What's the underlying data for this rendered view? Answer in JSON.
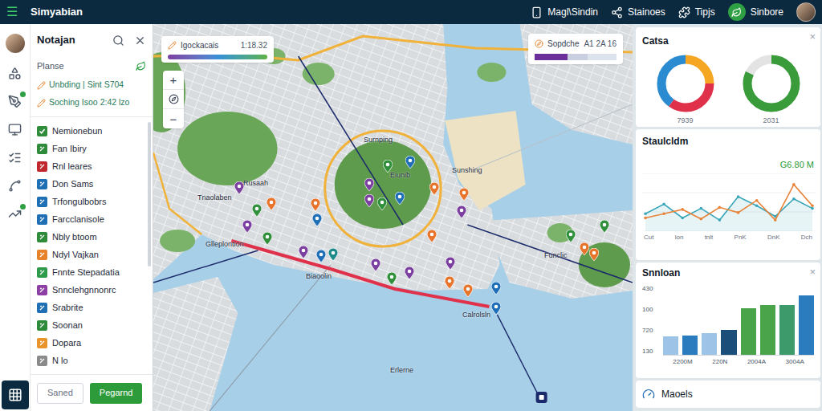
{
  "topbar": {
    "menu_glyph": "☰",
    "title": "Simyabian",
    "items": [
      {
        "label": "Magl\\Sindin"
      },
      {
        "label": "Stainoes"
      },
      {
        "label": "Tipjs"
      }
    ],
    "status": {
      "label": "Sinbore"
    }
  },
  "left_panel": {
    "title": "Notajan",
    "section": "Planse",
    "entries": [
      "Unbding | Sint S704",
      "Soching Isoo 2:42 lzo"
    ],
    "layers": [
      {
        "name": "Nemionebun",
        "color": "#2e8b3a",
        "checked": true
      },
      {
        "name": "Fan Ibiry",
        "color": "#2e8b3a",
        "checked": false
      },
      {
        "name": "Rnl leares",
        "color": "#c0282d",
        "checked": false
      },
      {
        "name": "Don Sams",
        "color": "#1f6fb5",
        "checked": false
      },
      {
        "name": "Trfongulbobrs",
        "color": "#1f6fb5",
        "checked": false
      },
      {
        "name": "Farcclanisole",
        "color": "#1f6fb5",
        "checked": false
      },
      {
        "name": "Nbly btoom",
        "color": "#2e8b3a",
        "checked": false
      },
      {
        "name": "Ndyl Vajkan",
        "color": "#e8822a",
        "checked": false
      },
      {
        "name": "Fnnte Stepadatia",
        "color": "#2e9b4a",
        "checked": false
      },
      {
        "name": "Snnclehgnnonrc",
        "color": "#8e3fa6",
        "checked": false
      },
      {
        "name": "Srabrite",
        "color": "#1f6fb5",
        "checked": false
      },
      {
        "name": "Soonan",
        "color": "#2e8b3a",
        "checked": false
      },
      {
        "name": "Dopara",
        "color": "#e8942a",
        "checked": false
      },
      {
        "name": "N lo",
        "color": "#8a8a8a",
        "checked": false
      }
    ],
    "buttons": [
      {
        "label": "Saned",
        "primary": false
      },
      {
        "label": "Pegarnd",
        "primary": true
      }
    ]
  },
  "map": {
    "legend": {
      "label": "Igockacais",
      "value": "1:18.32"
    },
    "scale_card": {
      "label": "Sopdche",
      "value": "A1 2A 16"
    },
    "zoom": {
      "in": "+",
      "out": "−"
    },
    "labels": [
      "Surnping",
      "Sunshing",
      "Tnaolaben",
      "Rusaah",
      "Eiunib",
      "Glleplontion",
      "Biaoolin",
      "Funclic",
      "Calrolsln",
      "Erlerne"
    ],
    "pins": [
      {
        "color": "#7b3fa0"
      },
      {
        "color": "#2f8f3a"
      },
      {
        "color": "#e8732a"
      },
      {
        "color": "#e8732a"
      },
      {
        "color": "#1e6fb8"
      },
      {
        "color": "#7b3fa0"
      },
      {
        "color": "#7b3fa0"
      },
      {
        "color": "#2f8f3a"
      },
      {
        "color": "#1e6fb8"
      },
      {
        "color": "#1e6fb8"
      },
      {
        "color": "#e8732a"
      },
      {
        "color": "#2f8f3a"
      },
      {
        "color": "#e8732a"
      },
      {
        "color": "#7b3fa0"
      },
      {
        "color": "#e8732a"
      },
      {
        "color": "#7b3fa0"
      },
      {
        "color": "#2f8f3a"
      },
      {
        "color": "#7b3fa0"
      },
      {
        "color": "#1e6fb8"
      },
      {
        "color": "#1d8a8a"
      },
      {
        "color": "#7b3fa0"
      },
      {
        "color": "#2f8f3a"
      },
      {
        "color": "#7b3fa0"
      },
      {
        "color": "#7b3fa0"
      },
      {
        "color": "#e8732a"
      },
      {
        "color": "#e8732a"
      },
      {
        "color": "#1e6fb8"
      },
      {
        "color": "#1e6fb8"
      },
      {
        "color": "#2f8f3a"
      },
      {
        "color": "#e8732a"
      },
      {
        "color": "#e8732a"
      },
      {
        "color": "#2f8f3a"
      }
    ]
  },
  "right_panel": {
    "donut_card": {
      "title": "Catsa",
      "close_glyph": "×",
      "donuts": [
        {
          "label": "7939",
          "segments": [
            {
              "value": 25,
              "color": "#f5a623"
            },
            {
              "value": 35,
              "color": "#e0314b"
            },
            {
              "value": 40,
              "color": "#2b8bd1"
            }
          ]
        },
        {
          "label": "2031",
          "segments": [
            {
              "value": 82,
              "color": "#3a9b3a"
            },
            {
              "value": 18,
              "color": "#e3e3e3"
            }
          ]
        }
      ]
    },
    "line_card": {
      "title": "Staulcldm",
      "value": "G6.80 M",
      "x_labels": [
        "Cut",
        "lon",
        "tnlt",
        "PnK",
        "DnK",
        "Dch"
      ],
      "series": [
        {
          "color": "#3aa6b9",
          "values": [
            30,
            48,
            22,
            40,
            18,
            62,
            45,
            25,
            58,
            40
          ]
        },
        {
          "color": "#e8833a",
          "values": [
            22,
            30,
            38,
            20,
            42,
            32,
            55,
            18,
            85,
            45
          ]
        }
      ]
    },
    "bar_card": {
      "title": "Snnloan",
      "close_glyph": "×",
      "y_ticks": [
        "430",
        "100",
        "720",
        "130"
      ],
      "x_labels": [
        "2200M",
        "220N",
        "2004A",
        "3004A"
      ],
      "bars": [
        {
          "value": 120,
          "color": "#9dc3e6"
        },
        {
          "value": 125,
          "color": "#2b7bbf"
        },
        {
          "value": 140,
          "color": "#9dc3e6"
        },
        {
          "value": 160,
          "color": "#1b4f7a"
        },
        {
          "value": 300,
          "color": "#4aa44a"
        },
        {
          "value": 320,
          "color": "#4aa44a"
        },
        {
          "value": 320,
          "color": "#3d9a6a"
        },
        {
          "value": 385,
          "color": "#2b7bbf"
        }
      ]
    },
    "models_card": {
      "title": "Maoels"
    }
  }
}
